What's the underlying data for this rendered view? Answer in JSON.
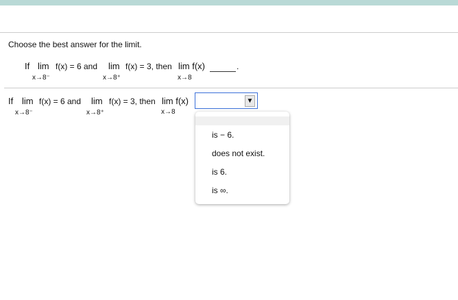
{
  "instruction": "Choose the best answer for the limit.",
  "question": {
    "if": "If",
    "lim": "lim",
    "part1": "f(x) = 6 and",
    "part2": "f(x) = 3, then",
    "lim_fx": "lim f(x)",
    "end": ".",
    "sub1": "x→8⁻",
    "sub2": "x→8⁺",
    "sub3": "x→8"
  },
  "answer_row": {
    "if": "If",
    "lim": "lim",
    "part1": "f(x) = 6 and",
    "part2": "f(x) = 3, then",
    "lim_fx": "lim f(x)",
    "sub1": "x→8⁻",
    "sub2": "x→8⁺",
    "sub3": "x→8",
    "selected": "",
    "arrow": "▼"
  },
  "options": [
    "is  − 6.",
    "does not exist.",
    "is 6.",
    "is ∞."
  ]
}
